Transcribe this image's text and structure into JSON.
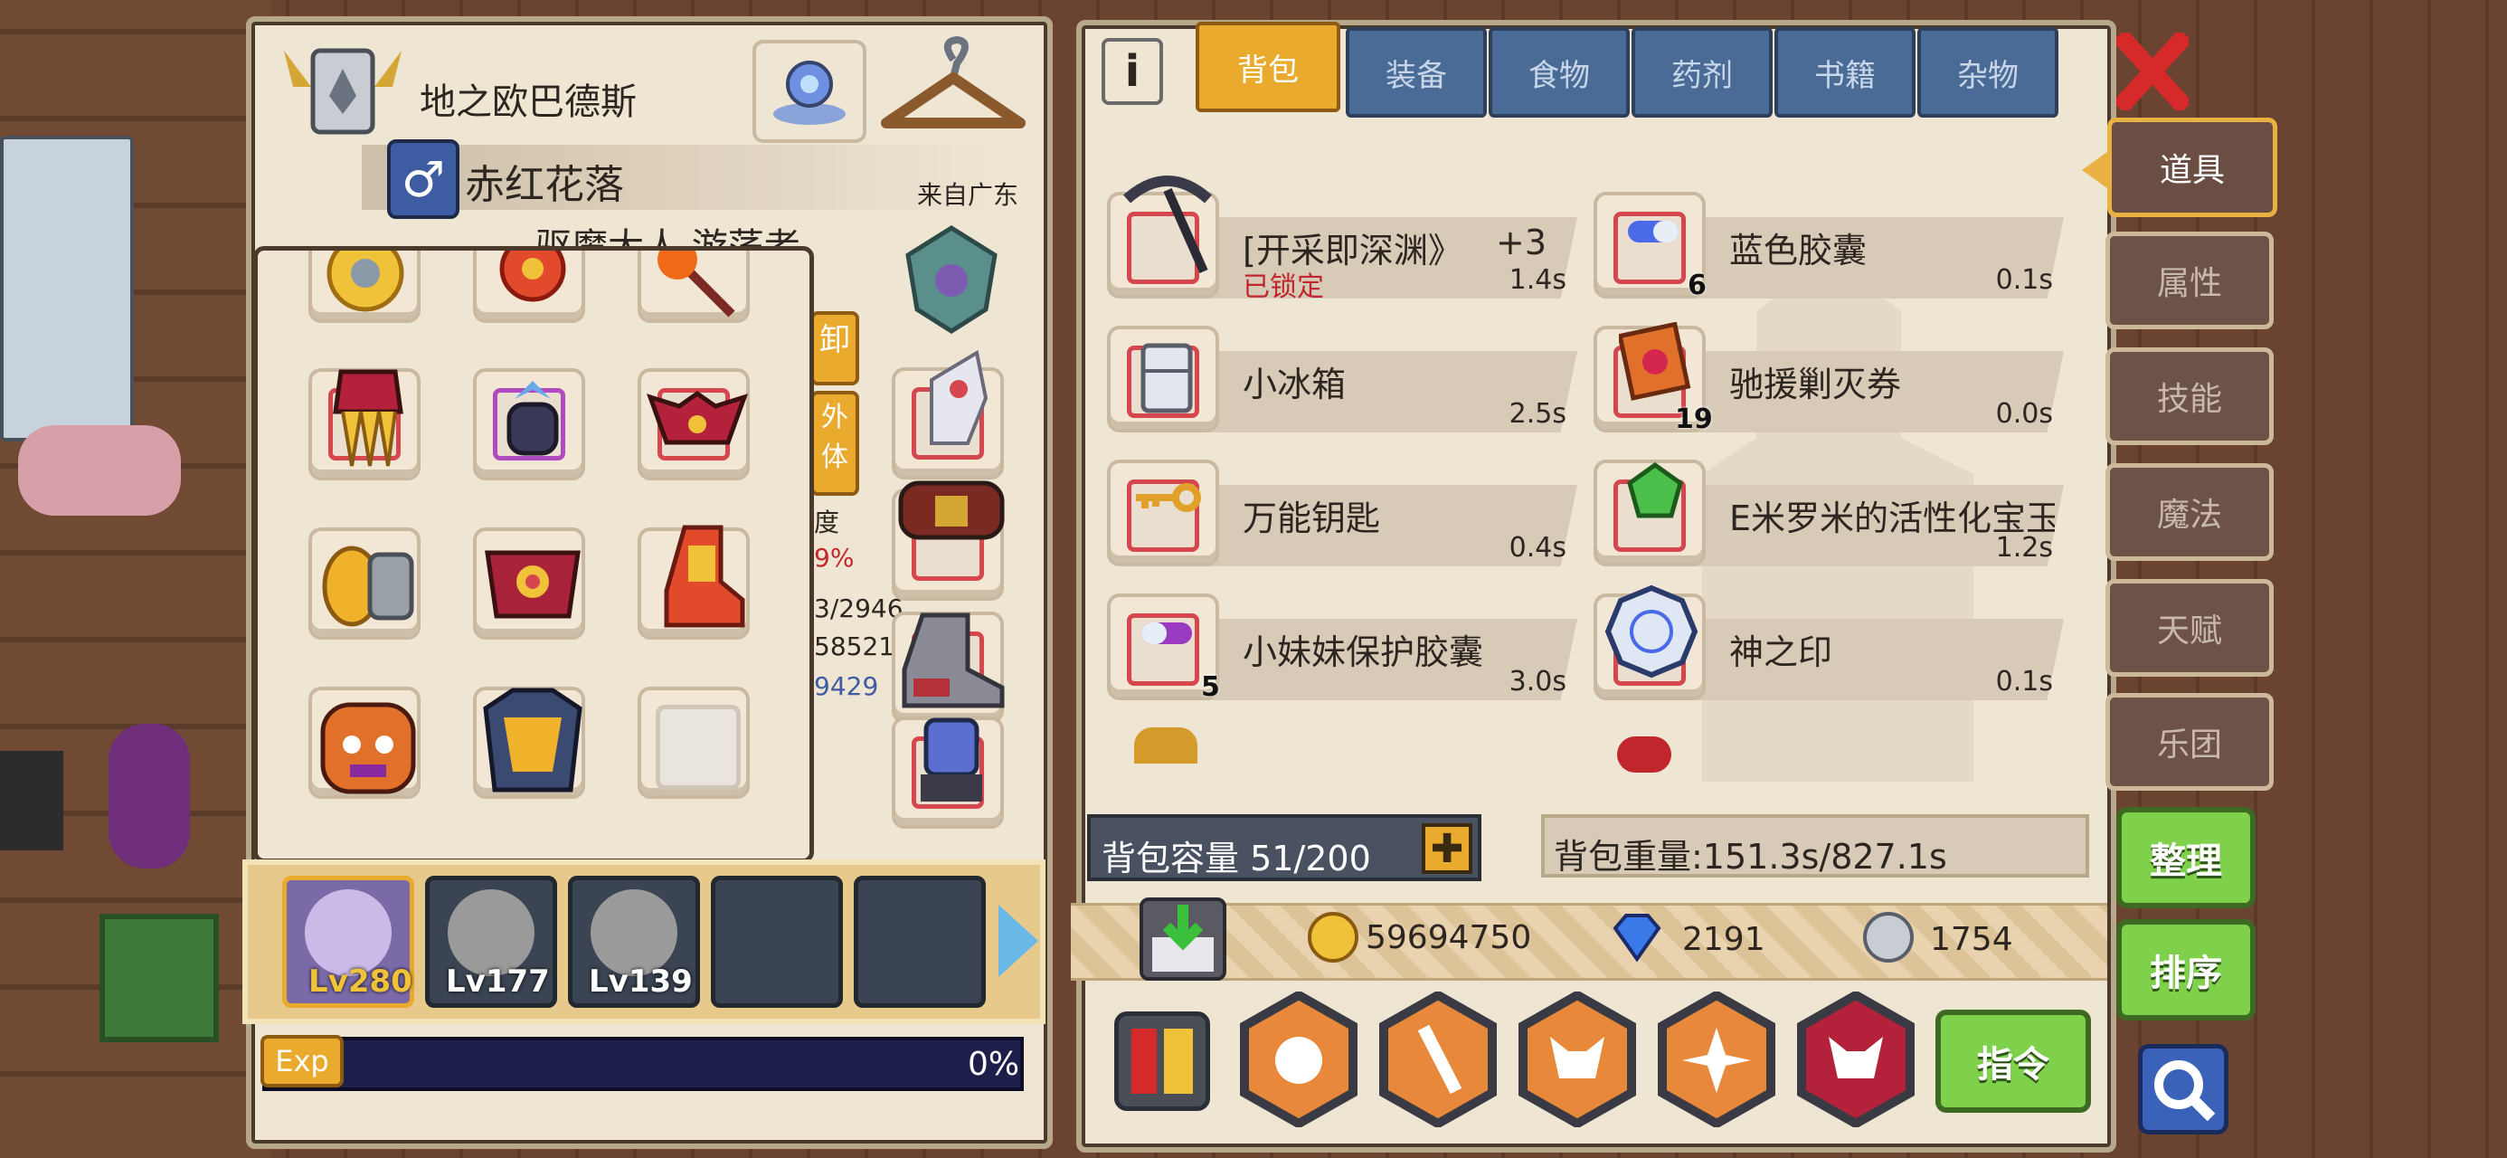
{
  "character": {
    "title": "地之欧巴德斯",
    "name": "赤红花落",
    "origin": "来自广东",
    "subtitle_partial": "驱魔大人 游荡者",
    "side_labels": {
      "unequip": "卸",
      "appearance": "外\n体",
      "stat_label": "度",
      "stat_pct": "9%",
      "stat_a": "3/2946",
      "stat_b": "58521",
      "stat_c": "9429"
    }
  },
  "party": {
    "members": [
      {
        "level": "Lv280"
      },
      {
        "level": "Lv177"
      },
      {
        "level": "Lv139"
      }
    ]
  },
  "exp": {
    "label": "Exp",
    "percent_text": "0%",
    "progress": 0
  },
  "tabs": {
    "info": "i",
    "items": [
      "背包",
      "装备",
      "食物",
      "药剂",
      "书籍",
      "杂物"
    ],
    "active": "背包"
  },
  "side_menu": {
    "items": [
      "道具",
      "属性",
      "技能",
      "魔法",
      "天赋",
      "乐团"
    ],
    "active": "道具"
  },
  "inventory": [
    {
      "name": "[开采即深渊》",
      "extra": "+3",
      "status": "已锁定",
      "time": "1.4s",
      "count": "",
      "icon": "pickaxe-icon"
    },
    {
      "name": "蓝色胶囊",
      "time": "0.1s",
      "count": "6",
      "icon": "blue-capsule-icon"
    },
    {
      "name": "小冰箱",
      "time": "2.5s",
      "count": "",
      "icon": "fridge-icon"
    },
    {
      "name": "驰援剿灭券",
      "time": "0.0s",
      "count": "19",
      "icon": "ticket-icon"
    },
    {
      "name": "万能钥匙",
      "time": "0.4s",
      "count": "",
      "icon": "key-icon"
    },
    {
      "name": "E米罗米的活性化宝玉",
      "time": "1.2s",
      "count": "",
      "icon": "green-gem-icon"
    },
    {
      "name": "小妹妹保护胶囊",
      "time": "3.0s",
      "count": "5",
      "icon": "purple-capsule-icon"
    },
    {
      "name": "神之印",
      "time": "0.1s",
      "count": "",
      "icon": "seal-icon"
    }
  ],
  "capacity": {
    "label": "背包容量 51/200",
    "weight": "背包重量:151.3s/827.1s"
  },
  "currency": {
    "gold": "59694750",
    "gems": "2191",
    "silver": "1754"
  },
  "buttons": {
    "organize": "整理",
    "sort": "排序",
    "command": "指令"
  },
  "colors": {
    "accent": "#e9aa2d",
    "tab_blue": "#4a6b95",
    "green_button": "#7fd04a",
    "panel": "#efe5d3"
  }
}
